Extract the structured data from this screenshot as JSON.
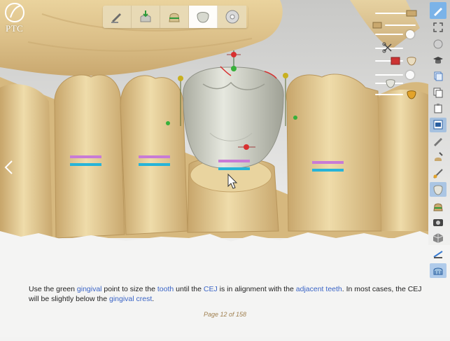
{
  "logo": {
    "text": "PTC"
  },
  "toolbar": {
    "tools": [
      {
        "icon": "brush-icon"
      },
      {
        "icon": "margin-tool-icon"
      },
      {
        "icon": "prep-tool-icon"
      },
      {
        "icon": "crown-tool-icon"
      },
      {
        "icon": "disc-icon"
      }
    ],
    "active_index": 3
  },
  "caption": {
    "parts": [
      {
        "text": "Use the green ",
        "highlight": false
      },
      {
        "text": "gingival",
        "highlight": true
      },
      {
        "text": " point to size the ",
        "highlight": false
      },
      {
        "text": "tooth",
        "highlight": true
      },
      {
        "text": " until the ",
        "highlight": false
      },
      {
        "text": "CEJ",
        "highlight": true
      },
      {
        "text": " is in alignment with the ",
        "highlight": false
      },
      {
        "text": "adjacent teeth",
        "highlight": true
      },
      {
        "text": ".  In most cases, the CEJ will be slightly below the ",
        "highlight": false
      },
      {
        "text": "gingival crest",
        "highlight": true
      },
      {
        "text": ".",
        "highlight": false
      }
    ],
    "highlight_color": "#3a64c6"
  },
  "page_indicator": "Page 12 of 158",
  "colors": {
    "cast": "#dcc089",
    "crown": "#d9dcd2",
    "cej_line": "#c87bd6",
    "gingival_line": "#27b4d8",
    "accent": "#7bb3e8"
  }
}
